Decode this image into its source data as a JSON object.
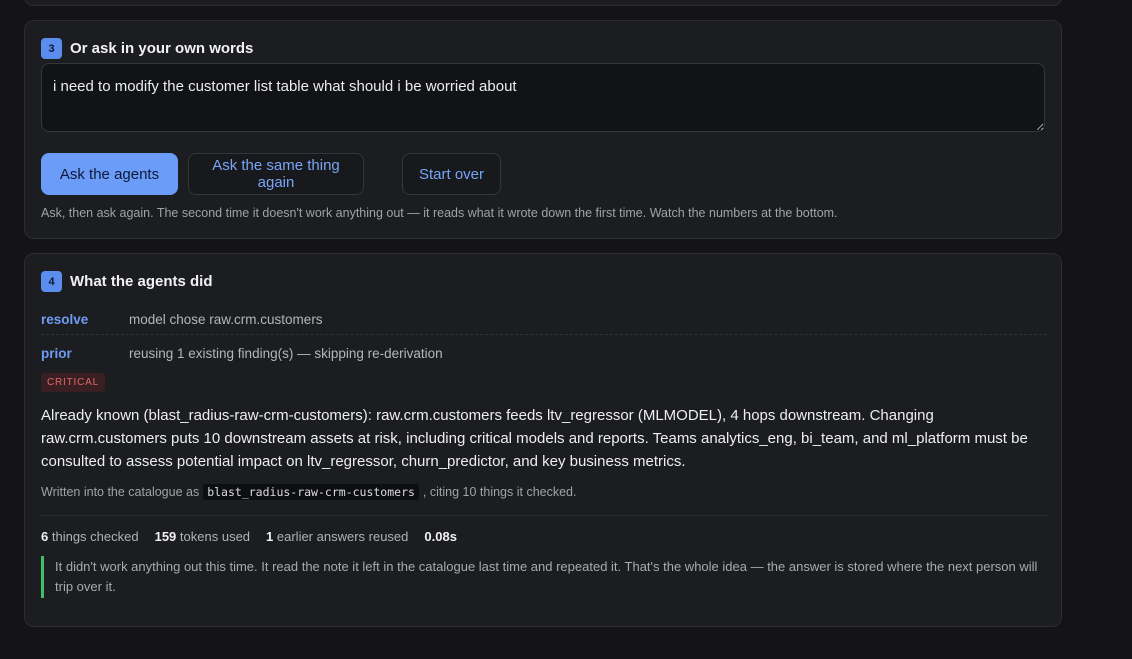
{
  "ask_section": {
    "step": "3",
    "title": "Or ask in your own words",
    "question": "i need to modify the customer list table what should i be worried about",
    "buttons": {
      "ask": "Ask the agents",
      "again": "Ask the same thing again",
      "reset": "Start over"
    },
    "hint": "Ask, then ask again. The second time it doesn't work anything out — it reads what it wrote down the first time. Watch the numbers at the bottom."
  },
  "results_section": {
    "step": "4",
    "title": "What the agents did",
    "steps": [
      {
        "key": "resolve",
        "text": "model chose raw.crm.customers"
      },
      {
        "key": "prior",
        "text": "reusing 1 existing finding(s) — skipping re-derivation"
      }
    ],
    "severity": "CRITICAL",
    "answer": "Already known (blast_radius-raw-crm-customers): raw.crm.customers feeds ltv_regressor (MLMODEL), 4 hops downstream. Changing raw.crm.customers puts 10 downstream assets at risk, including critical models and reports. Teams analytics_eng, bi_team, and ml_platform must be consulted to assess potential impact on ltv_regressor, churn_predictor, and key business metrics.",
    "written_prefix": "Written into the catalogue as",
    "written_id": "blast_radius-raw-crm-customers",
    "written_suffix": ", citing 10 things it checked.",
    "stats": {
      "checked_value": "6",
      "checked_label": "things checked",
      "tokens_value": "159",
      "tokens_label": "tokens used",
      "reused_value": "1",
      "reused_label": "earlier answers reused",
      "time_value": "0.08s"
    },
    "note": "It didn't work anything out this time. It read the note it left in the catalogue last time and repeated it. That's the whole idea — the answer is stored where the next person will trip over it."
  },
  "colors": {
    "accent": "#6b9cf8",
    "critical": "#e0686a",
    "success_bar": "#3fbf6a"
  }
}
